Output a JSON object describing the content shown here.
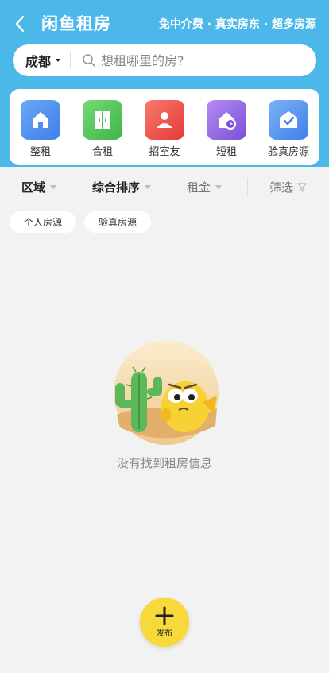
{
  "header": {
    "title": "闲鱼租房",
    "slogan": "免中介费 · 真实房东 · 超多房源",
    "background_color": "#4cb8ea"
  },
  "search": {
    "city": "成都",
    "placeholder": "想租哪里的房?",
    "value": ""
  },
  "categories": [
    {
      "label": "整租",
      "icon": "house-icon",
      "color": "#4c8ff0"
    },
    {
      "label": "合租",
      "icon": "door-icon",
      "color": "#56c75a"
    },
    {
      "label": "招室友",
      "icon": "person-icon",
      "color": "#ef5350"
    },
    {
      "label": "短租",
      "icon": "house-clock-icon",
      "color": "#9b6ee8"
    },
    {
      "label": "验真房源",
      "icon": "verified-house-icon",
      "color": "#4f93ec"
    }
  ],
  "filters": {
    "area": "区域",
    "sort": "综合排序",
    "rent": "租金",
    "screen": "筛选"
  },
  "tags": [
    "个人房源",
    "验真房源"
  ],
  "empty": {
    "message": "没有找到租房信息",
    "illustration": "cactus-and-fish-empty-illustration"
  },
  "publish": {
    "label": "发布",
    "color": "#f7d93a"
  }
}
